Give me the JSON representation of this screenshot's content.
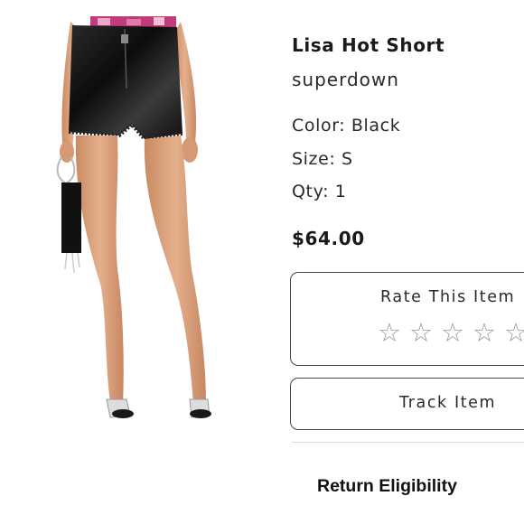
{
  "product": {
    "title": "Lisa Hot Short",
    "brand": "superdown",
    "color": "Color: Black",
    "size": "Size: S",
    "qty": "Qty: 1",
    "price": "$64.00"
  },
  "rating": {
    "label": "Rate This Item",
    "stars": [
      "☆",
      "☆",
      "☆",
      "☆",
      "☆"
    ]
  },
  "actions": {
    "track_label": "Track Item",
    "return_label": "Return Eligibility"
  },
  "colors": {
    "text": "#1a1a1a",
    "border": "#444444",
    "star": "#9a9a9a",
    "divider": "#d9d9d9"
  }
}
